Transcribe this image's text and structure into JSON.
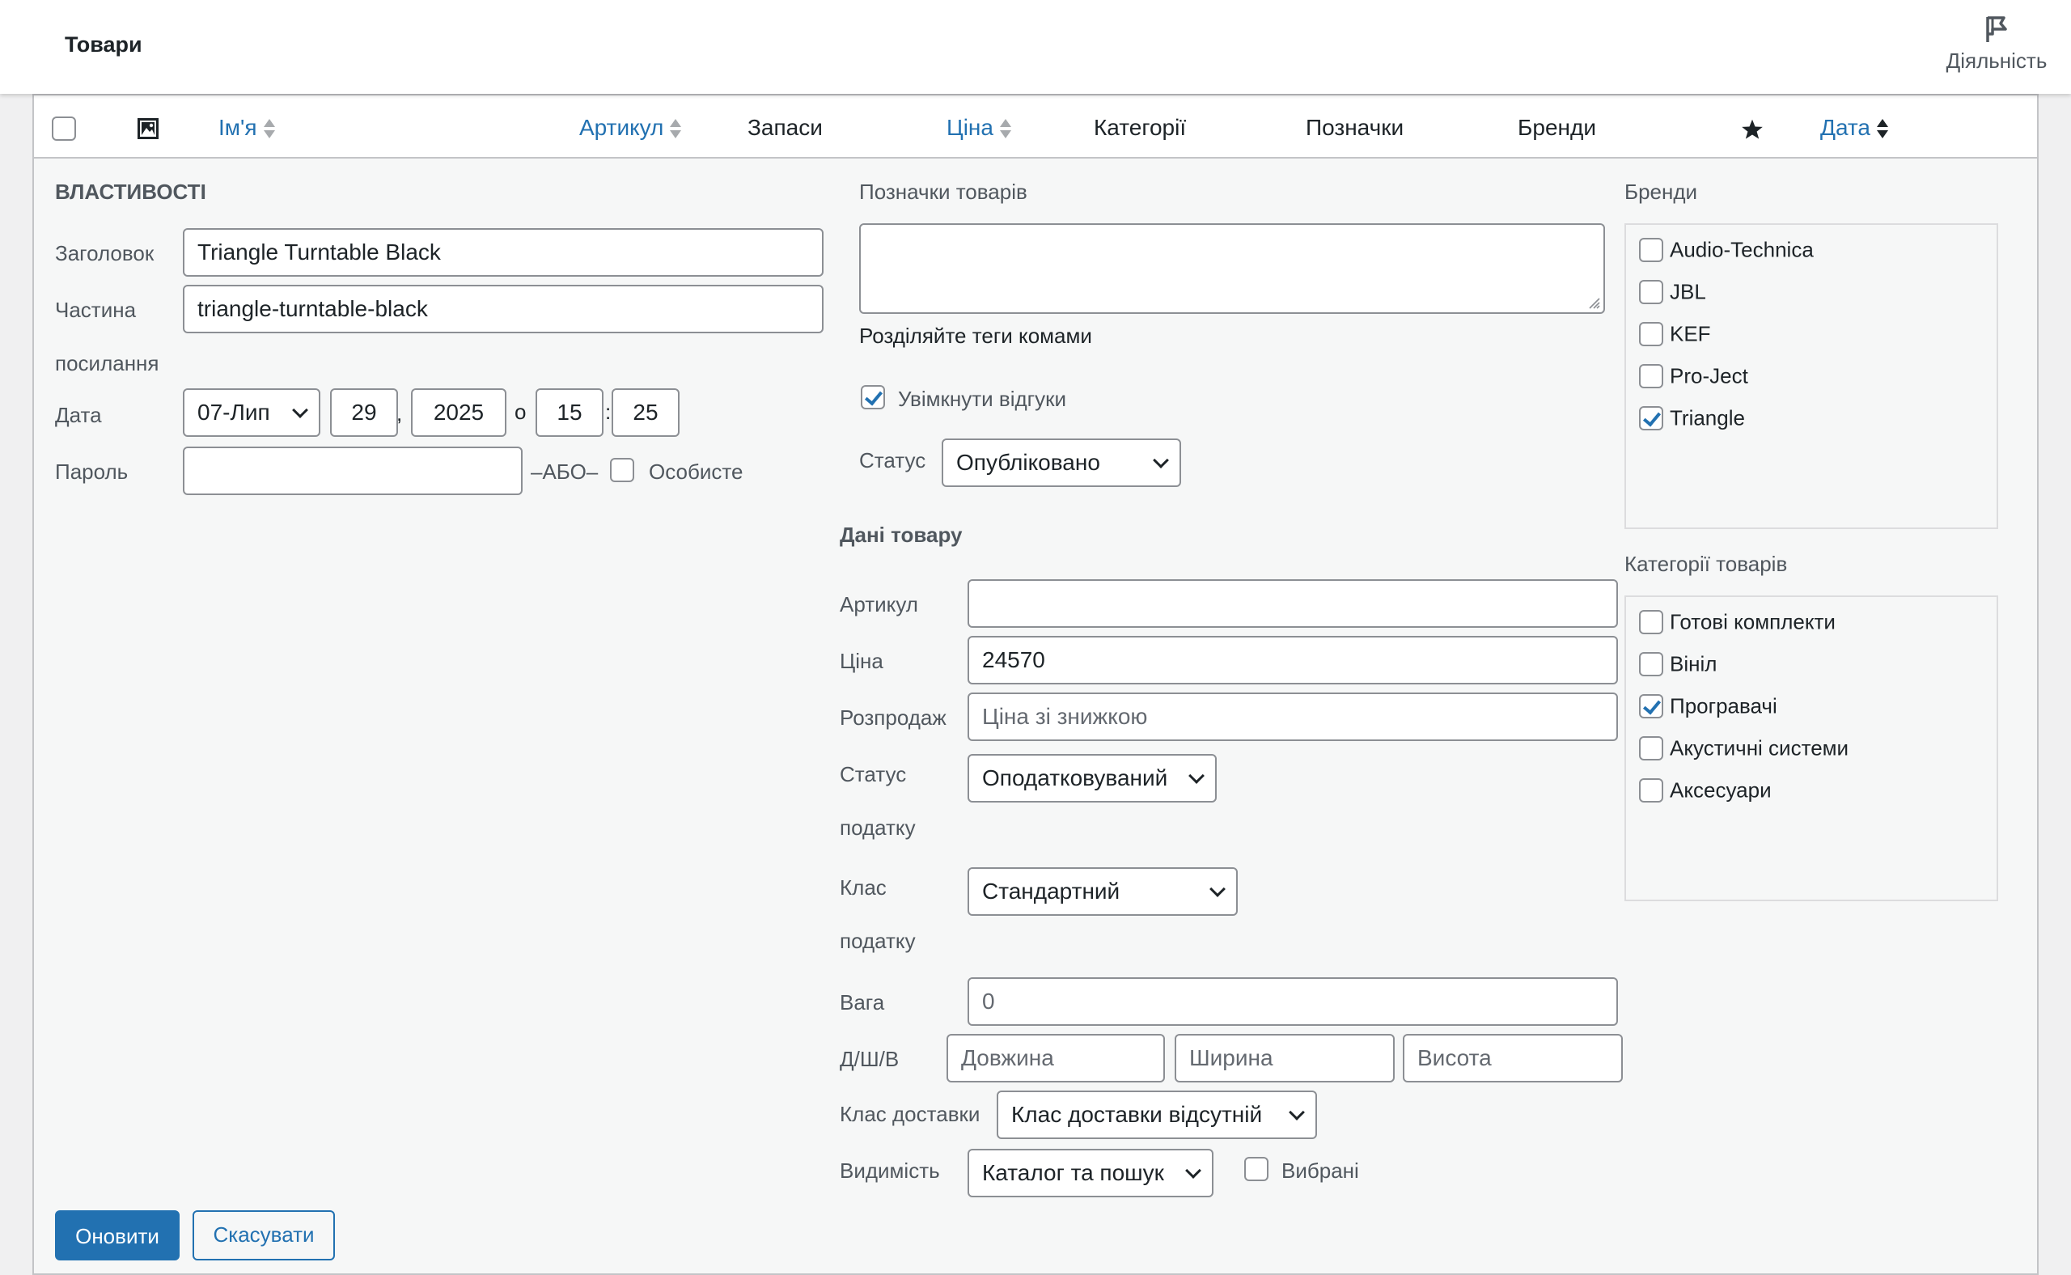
{
  "header": {
    "title": "Товари",
    "activity_label": "Діяльність"
  },
  "columns": {
    "name": "Ім'я",
    "sku": "Артикул",
    "stock": "Запаси",
    "price": "Ціна",
    "categories": "Категорії",
    "tags": "Позначки",
    "brands": "Бренди",
    "date": "Дата"
  },
  "properties": {
    "heading": "ВЛАСТИВОСТІ",
    "title_label": "Заголовок",
    "title_value": "Triangle Turntable Black",
    "slug_label_1": "Частина",
    "slug_label_2": "посилання",
    "slug_value": "triangle-turntable-black",
    "date_label": "Дата",
    "month": "07-Лип",
    "day": "29",
    "comma": ",",
    "year": "2025",
    "at": "о",
    "hour": "15",
    "colon": ":",
    "minute": "25",
    "password_label": "Пароль",
    "password_value": "",
    "or_label": "–АБО–",
    "private_label": "Особисте"
  },
  "tags_section": {
    "label": "Позначки товарів",
    "hint": "Розділяйте теги комами",
    "comments_label": "Увімкнути відгуки",
    "status_label": "Статус",
    "status_value": "Опубліковано"
  },
  "product_data": {
    "heading": "Дані товару",
    "sku_label": "Артикул",
    "sku_value": "",
    "price_label": "Ціна",
    "price_value": "24570",
    "sale_label": "Розпродаж",
    "sale_placeholder": "Ціна зі знижкою",
    "tax_status_label_1": "Статус",
    "tax_status_label_2": "податку",
    "tax_status_value": "Оподатковуваний",
    "tax_class_label_1": "Клас",
    "tax_class_label_2": "податку",
    "tax_class_value": "Стандартний",
    "weight_label": "Вага",
    "weight_placeholder": "0",
    "dims_label": "Д/Ш/В",
    "length_placeholder": "Довжина",
    "width_placeholder": "Ширина",
    "height_placeholder": "Висота",
    "shipping_label": "Клас доставки",
    "shipping_value": "Клас доставки відсутній",
    "visibility_label": "Видимість",
    "visibility_value": "Каталог та пошук",
    "featured_label": "Вибрані"
  },
  "brands": {
    "label": "Бренди",
    "items": [
      {
        "label": "Audio-Technica",
        "checked": false
      },
      {
        "label": "JBL",
        "checked": false
      },
      {
        "label": "KEF",
        "checked": false
      },
      {
        "label": "Pro-Ject",
        "checked": false
      },
      {
        "label": "Triangle",
        "checked": true
      }
    ]
  },
  "categories": {
    "label": "Категорії товарів",
    "items": [
      {
        "label": "Готові комплекти",
        "checked": false
      },
      {
        "label": "Вініл",
        "checked": false
      },
      {
        "label": "Програвачі",
        "checked": true
      },
      {
        "label": "Акустичні системи",
        "checked": false
      },
      {
        "label": "Аксесуари",
        "checked": false
      }
    ]
  },
  "actions": {
    "update": "Оновити",
    "cancel": "Скасувати"
  },
  "colors": {
    "accent": "#2271b1",
    "border": "#8c8f94",
    "panel_bg": "#f6f7f7"
  }
}
